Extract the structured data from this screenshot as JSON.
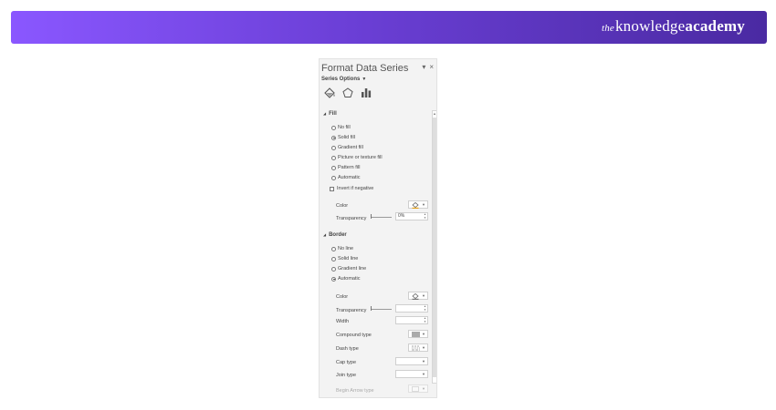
{
  "brand": {
    "prefix": "the",
    "part1": "knowledge",
    "part2": "academy"
  },
  "panel": {
    "title": "Format Data Series",
    "pin_glyph": "▾",
    "close_glyph": "×",
    "series_options": "Series Options",
    "series_caret": "▼",
    "tabs": [
      "fill-line-icon",
      "effects-pentagon-icon",
      "series-options-bar-icon"
    ]
  },
  "fill": {
    "header": "Fill",
    "options": [
      {
        "label": "No fill",
        "selected": false
      },
      {
        "label": "Solid fill",
        "selected": true
      },
      {
        "label": "Gradient fill",
        "selected": false
      },
      {
        "label": "Picture or texture fill",
        "selected": false
      },
      {
        "label": "Pattern fill",
        "selected": false
      },
      {
        "label": "Automatic",
        "selected": false
      }
    ],
    "invert_if_negative": "Invert if negative",
    "color_label": "Color",
    "transparency_label": "Transparency",
    "transparency_value": "0%"
  },
  "border": {
    "header": "Border",
    "options": [
      {
        "label": "No line",
        "selected": false
      },
      {
        "label": "Solid line",
        "selected": false
      },
      {
        "label": "Gradient line",
        "selected": false
      },
      {
        "label": "Automatic",
        "selected": true
      }
    ],
    "color_label": "Color",
    "transparency_label": "Transparency",
    "width_label": "Width",
    "compound_type_label": "Compound type",
    "dash_type_label": "Dash type",
    "cap_type_label": "Cap type",
    "join_type_label": "Join type",
    "begin_arrow_type_label": "Begin Arrow type"
  },
  "colors": {
    "banner_start": "#8a57ff",
    "banner_end": "#4a2aa2",
    "paint_bucket_accent": "#e8a317"
  }
}
